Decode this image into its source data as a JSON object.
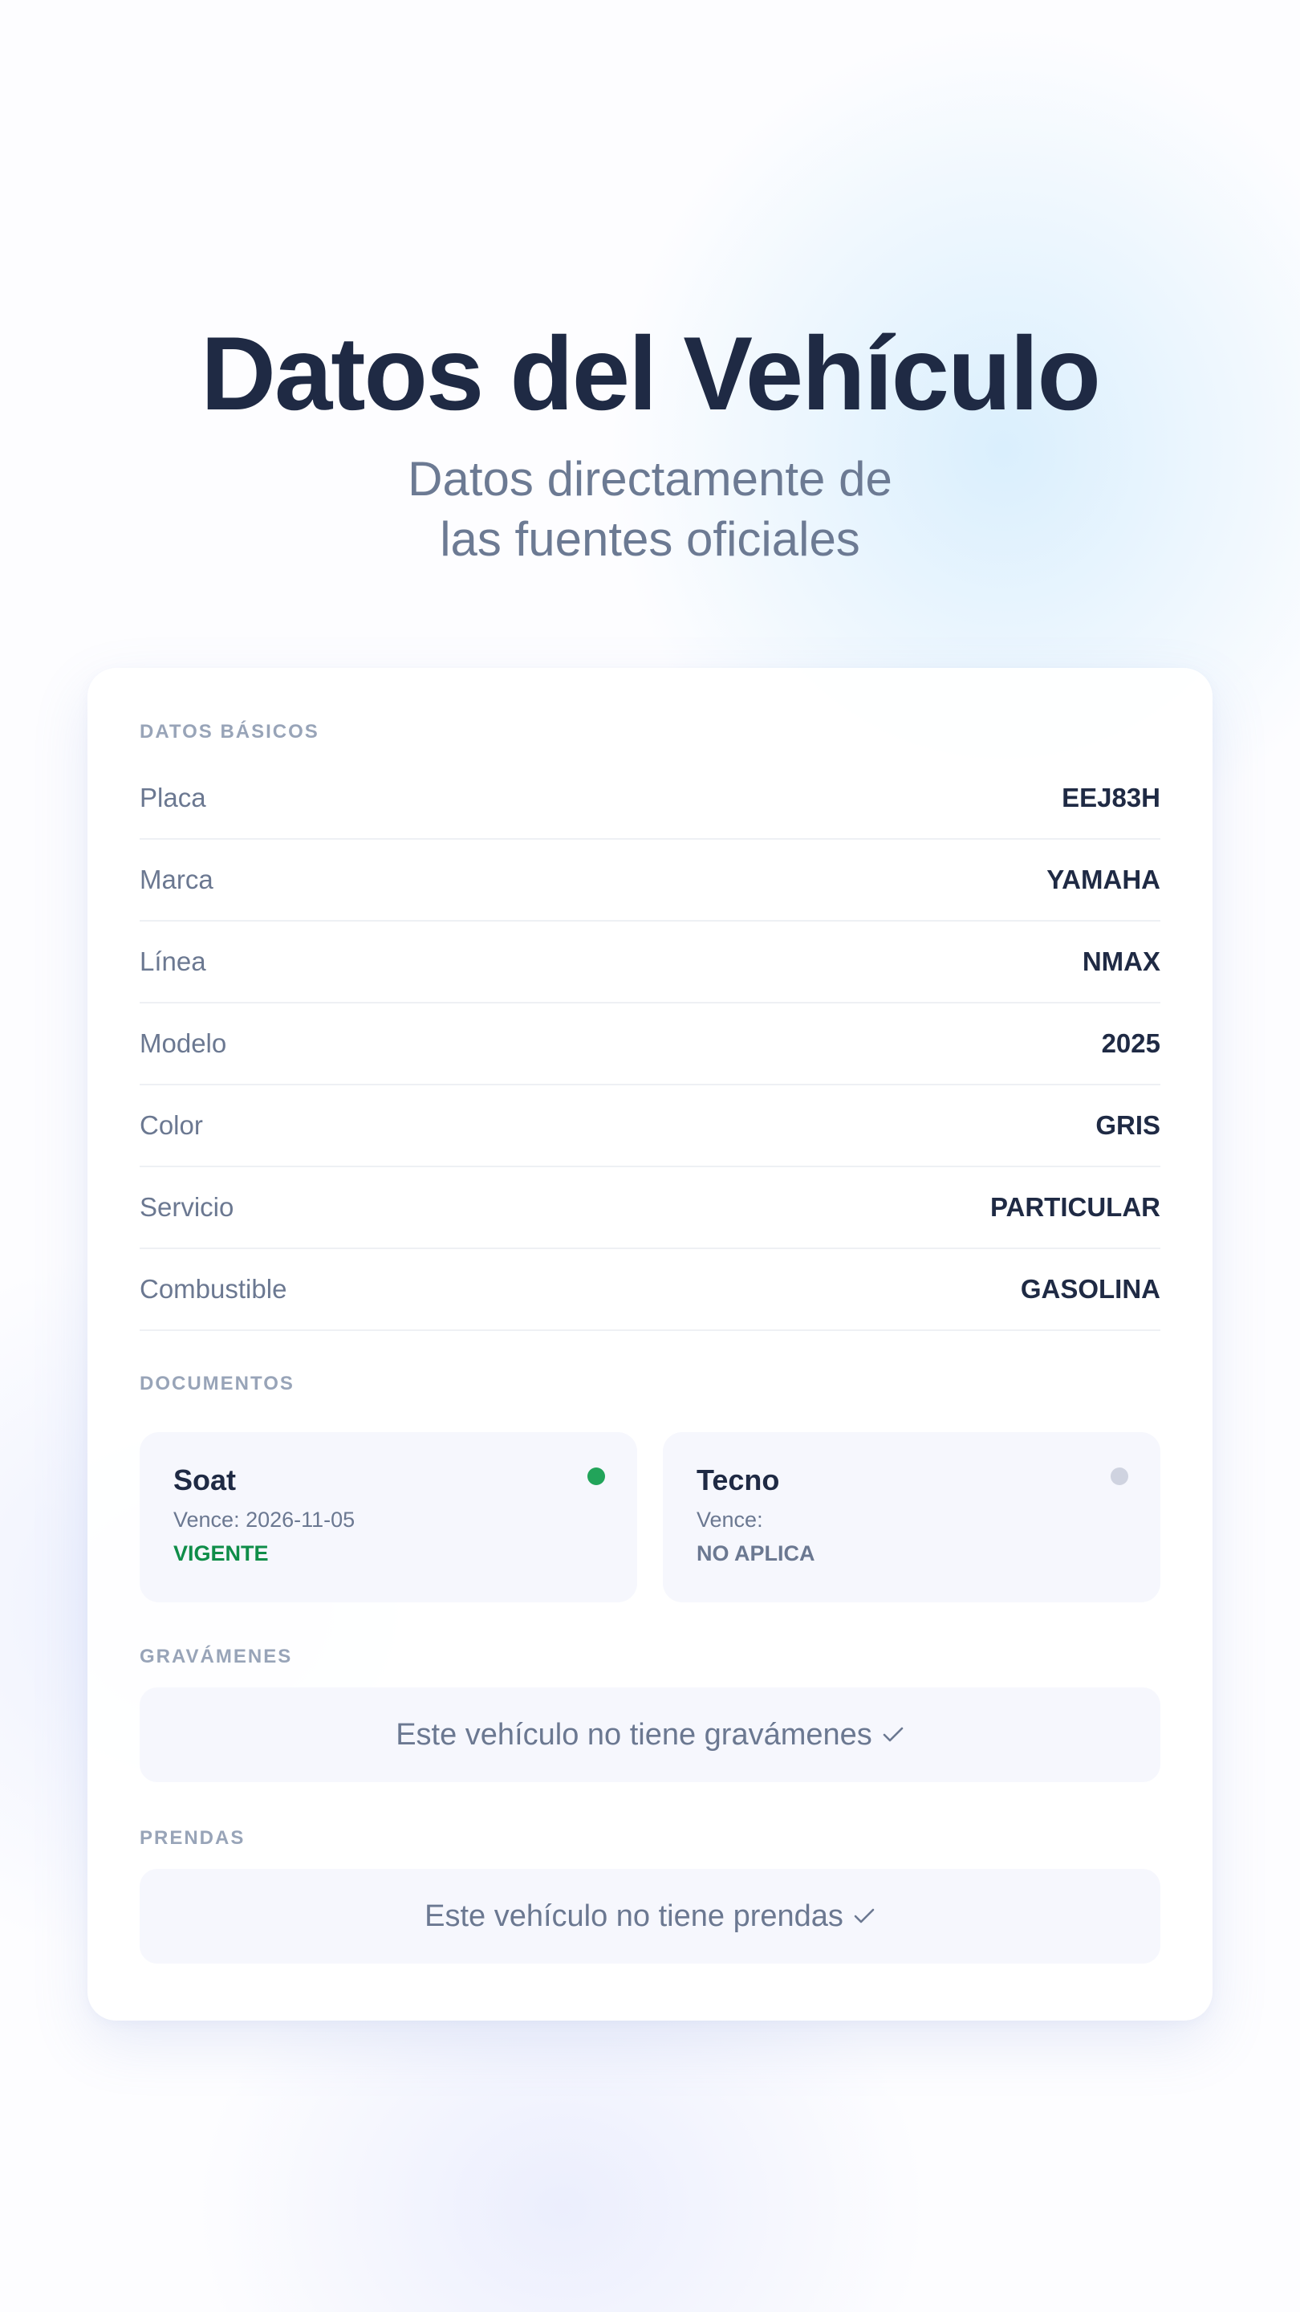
{
  "hero": {
    "title": "Datos del Vehículo",
    "subtitle_line1": "Datos directamente de",
    "subtitle_line2": "las fuentes oficiales"
  },
  "basic": {
    "section_label": "DATOS BÁSICOS",
    "rows": [
      {
        "label": "Placa",
        "value": "EEJ83H"
      },
      {
        "label": "Marca",
        "value": "YAMAHA"
      },
      {
        "label": "Línea",
        "value": "NMAX"
      },
      {
        "label": "Modelo",
        "value": "2025"
      },
      {
        "label": "Color",
        "value": "GRIS"
      },
      {
        "label": "Servicio",
        "value": "PARTICULAR"
      },
      {
        "label": "Combustible",
        "value": "GASOLINA"
      }
    ]
  },
  "documents": {
    "section_label": "DOCUMENTOS",
    "items": [
      {
        "name": "Soat",
        "vence": "Vence: 2026-11-05",
        "status": "VIGENTE",
        "indicator_color": "#22a45a"
      },
      {
        "name": "Tecno",
        "vence": "Vence:",
        "status": "NO APLICA",
        "indicator_color": "#cfd3e0"
      }
    ]
  },
  "gravamenes": {
    "section_label": "GRAVÁMENES",
    "message": "Este vehículo no tiene gravámenes",
    "icon": "check-icon"
  },
  "prendas": {
    "section_label": "PRENDAS",
    "message": "Este vehículo no tiene prendas",
    "icon": "check-icon"
  },
  "colors": {
    "heading": "#1f2a44",
    "muted": "#6b7891",
    "section_label": "#98a4b8",
    "status_valid": "#0f8d49"
  }
}
